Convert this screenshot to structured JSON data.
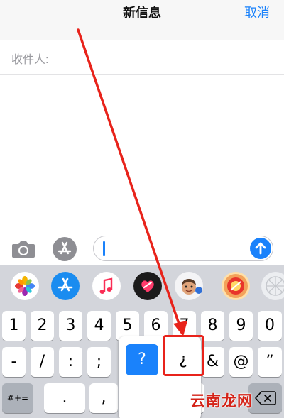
{
  "navbar": {
    "title": "新信息",
    "cancel_label": "取消"
  },
  "recipient": {
    "label": "收件人:"
  },
  "input_bar": {
    "message_value": "",
    "icons": [
      "camera-icon",
      "app-store-icon",
      "send-arrow-icon"
    ]
  },
  "app_drawer": {
    "apps": [
      {
        "name": "photos",
        "icon": "photos-icon"
      },
      {
        "name": "app-store",
        "icon": "app-store-icon"
      },
      {
        "name": "music",
        "icon": "music-icon"
      },
      {
        "name": "digital-touch",
        "icon": "digital-touch-icon"
      },
      {
        "name": "memoji",
        "icon": "memoji-icon"
      },
      {
        "name": "sticker",
        "icon": "sticker-icon"
      },
      {
        "name": "more",
        "icon": "more-apps-icon"
      }
    ]
  },
  "keyboard": {
    "row1": [
      "1",
      "2",
      "3",
      "4",
      "5",
      "6",
      "7",
      "8",
      "9",
      "0"
    ],
    "row2": [
      "-",
      "/",
      ":",
      ";",
      "&",
      "@",
      "”"
    ],
    "row3_left": "#+=",
    "row3": [
      ".",
      ",",
      "!"
    ],
    "delete_icon": "backspace-icon"
  },
  "popup": {
    "options": [
      "?",
      "¿"
    ],
    "selected": "?"
  },
  "annotation": {
    "color": "#e8231b",
    "highlighted_key": "¿"
  },
  "watermark": {
    "text": "云南龙网"
  },
  "colors": {
    "accent": "#1a82fb",
    "keyboard_bg": "#d3d5db",
    "nav_bg": "#f7f7f7",
    "annotation_red": "#e8231b"
  }
}
